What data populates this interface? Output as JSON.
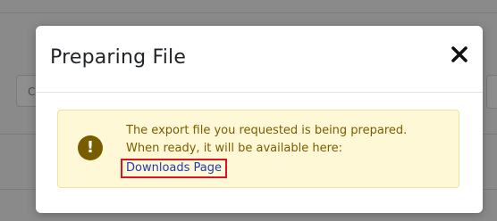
{
  "background": {
    "input_left_text": "C"
  },
  "modal": {
    "title": "Preparing File",
    "close_icon": "close-icon",
    "alert": {
      "icon": "exclamation-icon",
      "line1": "The export file you requested is being prepared.",
      "line2": "When ready, it will be available here:",
      "link_label": "Downloads Page"
    }
  },
  "colors": {
    "alert_background": "#fff8d6",
    "alert_border": "#f5e29a",
    "alert_text": "#7a5c00",
    "link": "#1f3bb3",
    "highlight_border": "#d9131f",
    "overlay": "#8a8a8a"
  }
}
